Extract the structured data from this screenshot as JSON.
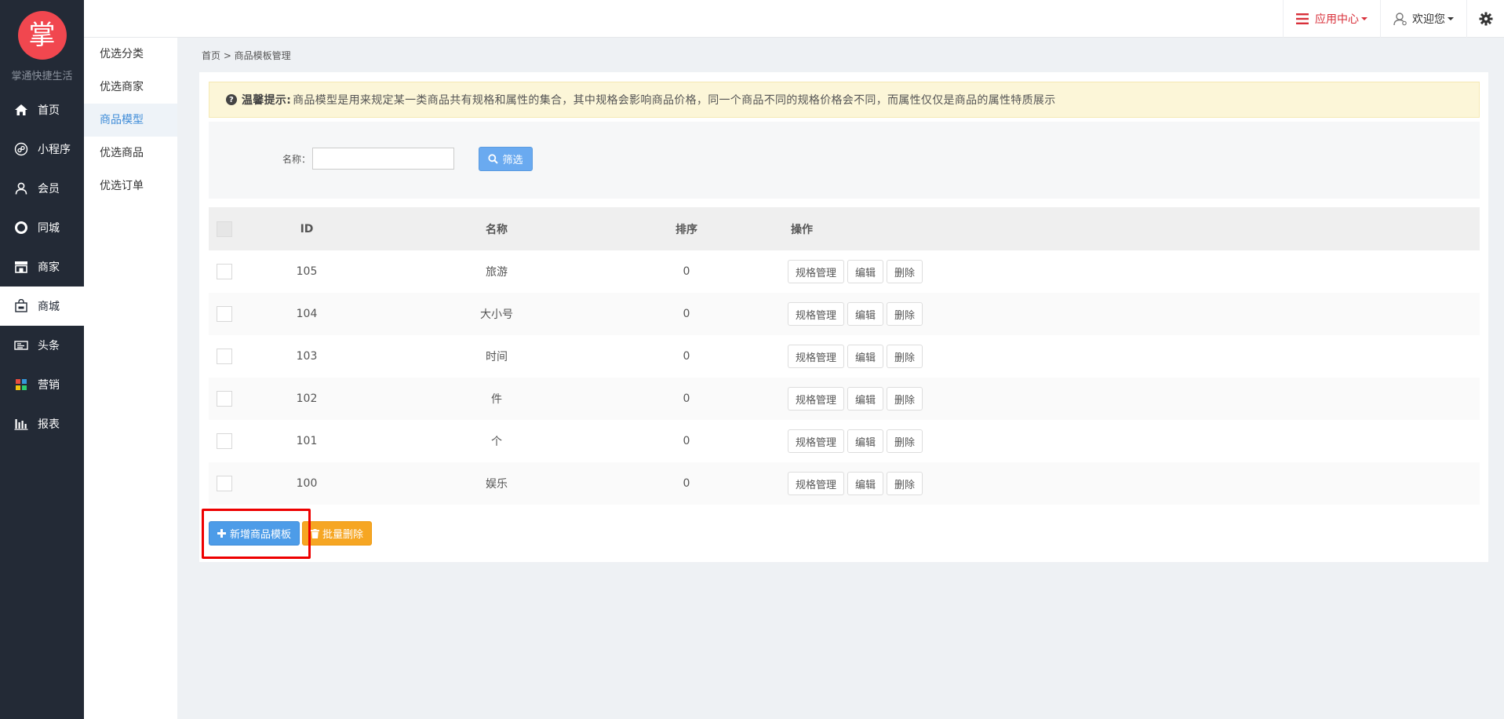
{
  "brand": {
    "logo_char": "掌",
    "name": "掌通快捷生活"
  },
  "sidebar": {
    "items": [
      {
        "label": "首页",
        "icon": "home-icon"
      },
      {
        "label": "小程序",
        "icon": "miniprogram-icon"
      },
      {
        "label": "会员",
        "icon": "user-icon"
      },
      {
        "label": "同城",
        "icon": "circle-icon"
      },
      {
        "label": "商家",
        "icon": "store-icon"
      },
      {
        "label": "商城",
        "icon": "shop-icon",
        "active": true
      },
      {
        "label": "头条",
        "icon": "ticket-icon"
      },
      {
        "label": "营销",
        "icon": "grid-icon"
      },
      {
        "label": "报表",
        "icon": "bar-chart-icon"
      }
    ]
  },
  "subnav": {
    "items": [
      "优选分类",
      "优选商家",
      "商品模型",
      "优选商品",
      "优选订单"
    ],
    "active_index": 2
  },
  "topbar": {
    "app_center": "应用中心",
    "welcome": "欢迎您",
    "accent": "#d8303a"
  },
  "breadcrumb": "首页 > 商品模板管理",
  "tip": {
    "title": "温馨提示:",
    "text": "商品模型是用来规定某一类商品共有规格和属性的集合，其中规格会影响商品价格，同一个商品不同的规格价格会不同，而属性仅仅是商品的属性特质展示"
  },
  "filter": {
    "label": "名称：",
    "value": "",
    "button": "筛选"
  },
  "table": {
    "headers": {
      "id": "ID",
      "name": "名称",
      "sort": "排序",
      "op": "操作"
    },
    "rows": [
      {
        "id": "105",
        "name": "旅游",
        "sort": "0"
      },
      {
        "id": "104",
        "name": "大小号",
        "sort": "0"
      },
      {
        "id": "103",
        "name": "时间",
        "sort": "0"
      },
      {
        "id": "102",
        "name": "件",
        "sort": "0"
      },
      {
        "id": "101",
        "name": "个",
        "sort": "0"
      },
      {
        "id": "100",
        "name": "娱乐",
        "sort": "0"
      }
    ],
    "actions": {
      "spec": "规格管理",
      "edit": "编辑",
      "del": "删除"
    }
  },
  "bottom": {
    "add": "新增商品模板",
    "batch_delete": "批量删除"
  },
  "colors": {
    "sidebar": "#232a36",
    "primary": "#4d9ce8",
    "warning": "#f6a623",
    "highlight": "#e00000"
  }
}
